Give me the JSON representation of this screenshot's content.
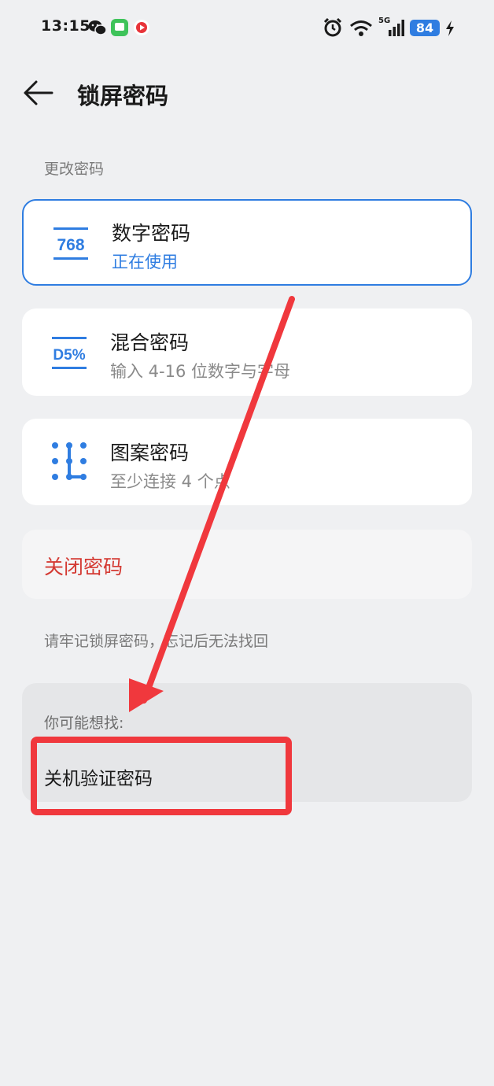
{
  "status_bar": {
    "time": "13:15",
    "network": "5G",
    "battery": "84",
    "icons": [
      "wechat-icon",
      "message-app-icon",
      "video-app-icon",
      "alarm-icon",
      "wifi-icon",
      "signal-icon",
      "battery-icon",
      "charging-icon"
    ]
  },
  "header": {
    "back_icon": "arrow-left-icon",
    "title": "锁屏密码"
  },
  "section_label": "更改密码",
  "options": [
    {
      "icon_text": "768",
      "title": "数字密码",
      "subtitle": "正在使用",
      "selected": true
    },
    {
      "icon_text": "D5%",
      "title": "混合密码",
      "subtitle": "输入 4-16 位数字与字母",
      "selected": false
    },
    {
      "icon": "pattern-grid-icon",
      "title": "图案密码",
      "subtitle": "至少连接 4 个点",
      "selected": false
    }
  ],
  "disable": {
    "label": "关闭密码",
    "color": "#d43a33"
  },
  "hint": "请牢记锁屏密码，忘记后无法找回",
  "suggestions": {
    "title": "你可能想找:",
    "link": "关机验证密码"
  },
  "colors": {
    "accent": "#2f7de1",
    "annotation_red": "#f0383d",
    "background": "#eff0f2"
  }
}
